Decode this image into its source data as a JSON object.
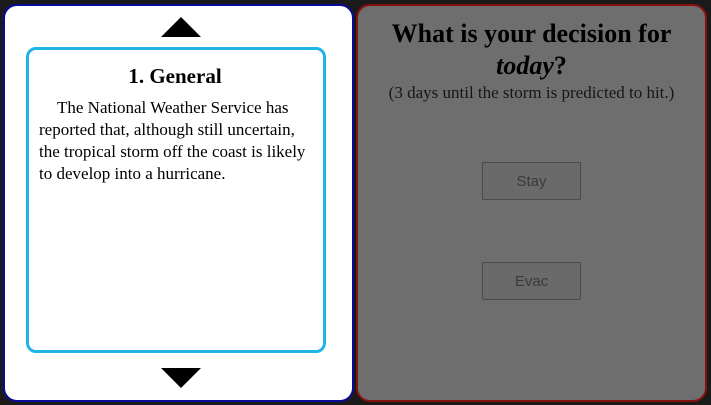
{
  "info_panel": {
    "card_title": "1. General",
    "card_body": "The National Weather Service has reported that, although still uncertain, the tropical storm off the coast is likely to develop into a hurricane."
  },
  "decision_panel": {
    "question_prefix": "What is your decision for",
    "question_emphasis": "today",
    "question_suffix": "?",
    "subtext": "(3 days until the storm is predicted to hit.)",
    "buttons": {
      "stay": "Stay",
      "evac": "Evac"
    }
  },
  "colors": {
    "left_border": "#0a0a9a",
    "card_border": "#1fb3e6",
    "right_border": "#8a0f0f",
    "right_background": "#6e6e6e"
  },
  "icons": {
    "scroll_up": "triangle-up-icon",
    "scroll_down": "triangle-down-icon"
  }
}
